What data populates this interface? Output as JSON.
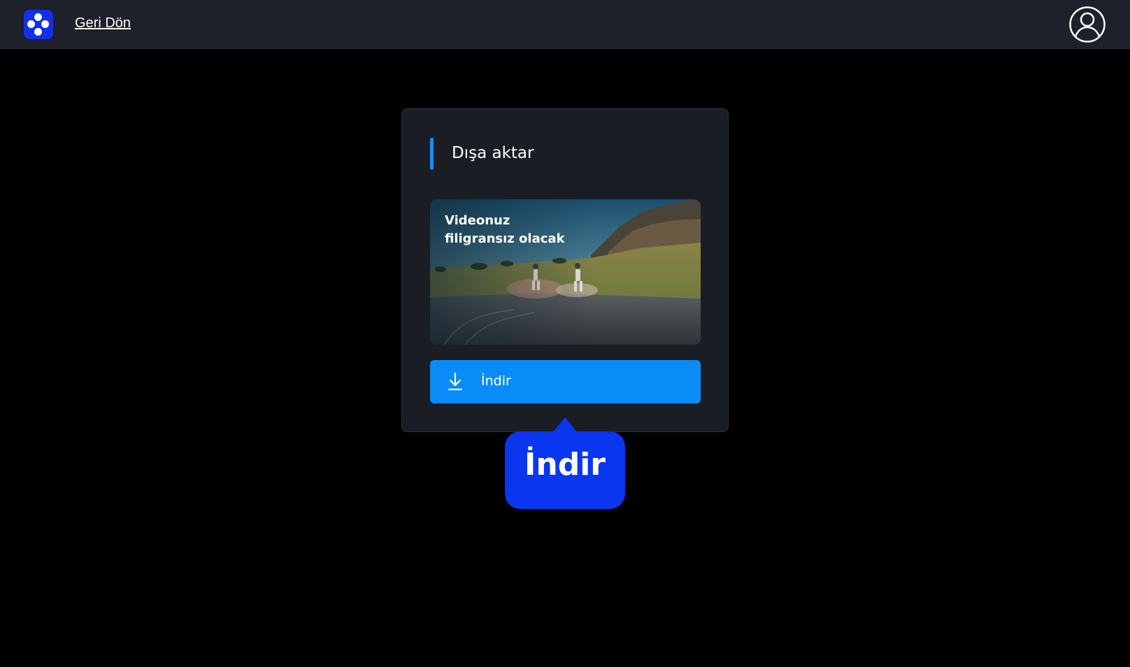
{
  "header": {
    "back_label": "Geri Dön",
    "logo_icon": "app-logo-icon",
    "account_icon": "user-account-icon"
  },
  "export_panel": {
    "title": "Dışa aktar",
    "preview_text_line1": "Videonuz",
    "preview_text_line2": "filigransız olacak",
    "download_label": "İndir",
    "download_icon": "download-icon"
  },
  "tooltip": {
    "text": "İndir"
  },
  "colors": {
    "accent": "#1a8cff",
    "button": "#0a8cf8",
    "tooltip": "#0a36f0",
    "topbar": "#1e202a",
    "card": "#1b1d25"
  }
}
